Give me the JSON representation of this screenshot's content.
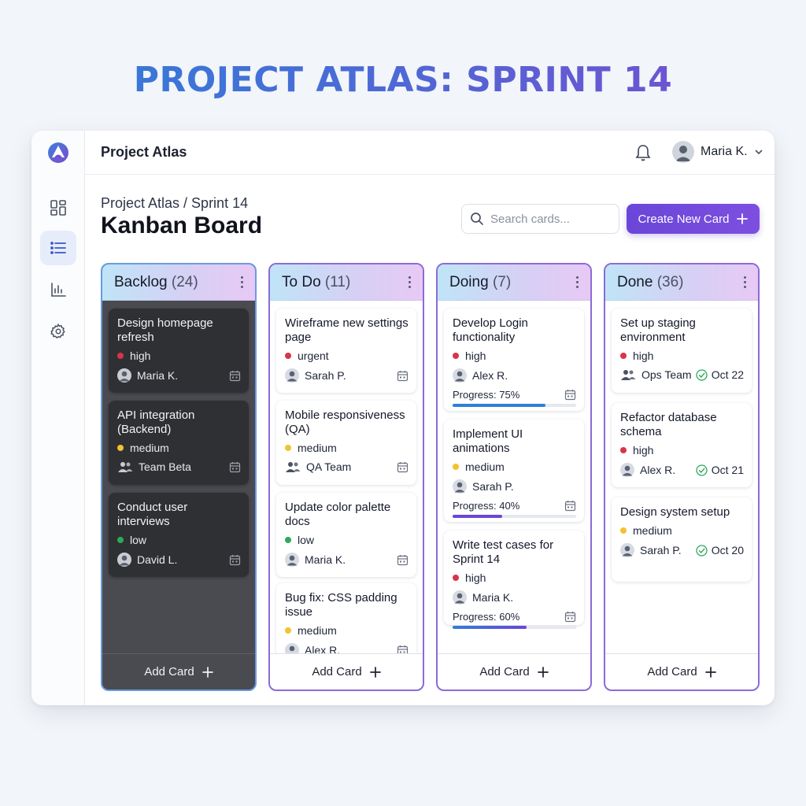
{
  "hero": {
    "title": "PROJECT ATLAS: SPRINT 14"
  },
  "topbar": {
    "app_name": "Project Atlas",
    "user_name": "Maria K."
  },
  "header": {
    "breadcrumb": "Project Atlas / Sprint 14",
    "page_title": "Kanban Board",
    "search_placeholder": "Search cards...",
    "create_label": "Create New Card"
  },
  "sidebar": {
    "items": [
      {
        "icon": "dashboard-icon",
        "active": false
      },
      {
        "icon": "list-icon",
        "active": true
      },
      {
        "icon": "bar-chart-icon",
        "active": false
      },
      {
        "icon": "gear-icon",
        "active": false
      }
    ]
  },
  "colors": {
    "high": "#d8344a",
    "urgent": "#d8344a",
    "medium": "#f2c230",
    "low": "#2ea95a",
    "progress_blue": "#2f7fd8",
    "progress_purple": "#6a46d8",
    "check": "#2ea95a"
  },
  "columns": [
    {
      "title": "Backlog",
      "count": "(24)",
      "add_label": "Add Card",
      "cards": [
        {
          "title": "Design homepage refresh",
          "priority": "high",
          "assignee": "Maria K.",
          "assignee_icon": "avatar-icon",
          "due_icon": "calendar-icon"
        },
        {
          "title": "API integration (Backend)",
          "priority": "medium",
          "assignee": "Team Beta",
          "assignee_icon": "team-icon",
          "due_icon": "calendar-icon"
        },
        {
          "title": "Conduct user interviews",
          "priority": "low",
          "assignee": "David L.",
          "assignee_icon": "avatar-icon",
          "due_icon": "calendar-icon"
        }
      ]
    },
    {
      "title": "To Do",
      "count": "(11)",
      "add_label": "Add Card",
      "cards": [
        {
          "title": "Wireframe new settings page",
          "priority": "urgent",
          "assignee": "Sarah P.",
          "assignee_icon": "avatar-icon",
          "due_icon": "calendar-icon"
        },
        {
          "title": "Mobile responsiveness (QA)",
          "priority": "medium",
          "assignee": "QA Team",
          "assignee_icon": "team-icon",
          "due_icon": "calendar-icon"
        },
        {
          "title": "Update color palette docs",
          "priority": "low",
          "assignee": "Maria K.",
          "assignee_icon": "avatar-icon",
          "due_icon": "calendar-icon"
        },
        {
          "title": "Bug fix: CSS padding issue",
          "priority": "medium",
          "assignee": "Alex R.",
          "assignee_icon": "avatar-icon",
          "due_icon": "calendar-icon"
        }
      ]
    },
    {
      "title": "Doing",
      "count": "(7)",
      "add_label": "Add Card",
      "cards": [
        {
          "title": "Develop Login functionality",
          "priority": "high",
          "assignee": "Alex R.",
          "progress_label": "Progress: 75%",
          "progress": 0.75,
          "progress_color": "blue"
        },
        {
          "title": "Implement UI animations",
          "priority": "medium",
          "assignee": "Sarah P.",
          "progress_label": "Progress: 40%",
          "progress": 0.4,
          "progress_color": "purple"
        },
        {
          "title": "Write test cases for Sprint 14",
          "priority": "high",
          "assignee": "Maria K.",
          "progress_label": "Progress: 60%",
          "progress": 0.6,
          "progress_color": "blue-purple"
        }
      ]
    },
    {
      "title": "Done",
      "count": "(36)",
      "add_label": "Add Card",
      "cards": [
        {
          "title": "Set up staging environment",
          "priority": "high",
          "assignee": "Ops Team",
          "assignee_icon": "team-icon",
          "due": "Oct 22"
        },
        {
          "title": "Refactor database schema",
          "priority": "high",
          "assignee": "Alex R.",
          "assignee_icon": "avatar-icon",
          "due": "Oct 21"
        },
        {
          "title": "Design system setup",
          "priority": "medium",
          "assignee": "Sarah P.",
          "assignee_icon": "avatar-icon",
          "due": "Oct 20"
        }
      ]
    }
  ]
}
